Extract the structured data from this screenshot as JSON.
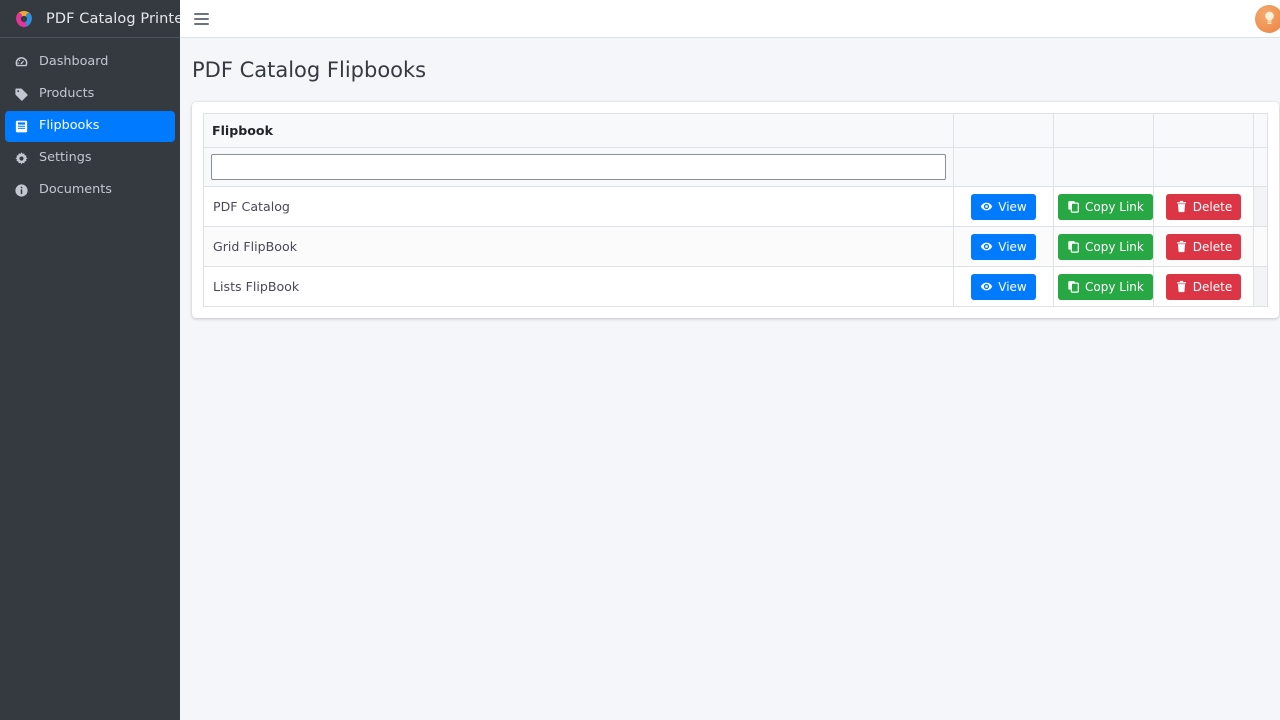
{
  "brand": {
    "title": "PDF Catalog Printer",
    "logo_icon": "triple-ring-logo"
  },
  "sidebar": {
    "items": [
      {
        "label": "Dashboard",
        "icon": "tachometer-icon",
        "active": false
      },
      {
        "label": "Products",
        "icon": "tag-icon",
        "active": false
      },
      {
        "label": "Flipbooks",
        "icon": "book-icon",
        "active": true
      },
      {
        "label": "Settings",
        "icon": "gear-icon",
        "active": false
      },
      {
        "label": "Documents",
        "icon": "info-circle-icon",
        "active": false
      }
    ]
  },
  "topbar": {
    "menu_icon": "hamburger-icon",
    "help_icon": "lightbulb-icon"
  },
  "page": {
    "title": "PDF Catalog Flipbooks"
  },
  "table": {
    "columns": [
      "Flipbook",
      "",
      "",
      ""
    ],
    "filter": {
      "value": "",
      "placeholder": ""
    },
    "rows": [
      {
        "name": "PDF Catalog",
        "view_label": "View",
        "copy_label": "Copy Link",
        "delete_label": "Delete"
      },
      {
        "name": "Grid FlipBook",
        "view_label": "View",
        "copy_label": "Copy Link",
        "delete_label": "Delete"
      },
      {
        "name": "Lists FlipBook",
        "view_label": "View",
        "copy_label": "Copy Link",
        "delete_label": "Delete"
      }
    ]
  },
  "colors": {
    "sidebar_bg": "#343a40",
    "active_nav": "#007bff",
    "page_bg": "#f4f6f9",
    "view_btn": "#007bff",
    "copy_btn": "#28a745",
    "delete_btn": "#dc3545",
    "help_btn": "#ee8f4e"
  }
}
